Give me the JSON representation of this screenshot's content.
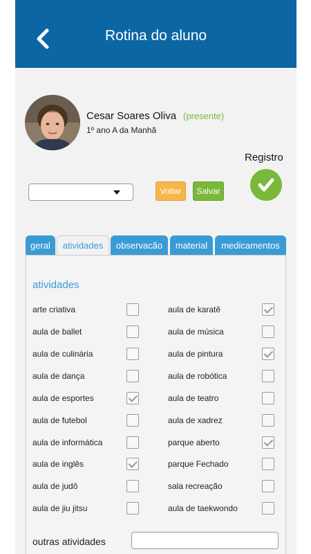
{
  "header": {
    "title": "Rotina do aluno"
  },
  "student": {
    "name": "Cesar Soares Oliva",
    "status": "(presente)",
    "class": "1º ano A da Manhã"
  },
  "registro": {
    "label": "Registro"
  },
  "select": {
    "value": ""
  },
  "buttons": {
    "voltar": "Voltar",
    "salvar": "Salvar"
  },
  "tabs": [
    {
      "label": "geral",
      "active": false
    },
    {
      "label": "atividades",
      "active": true
    },
    {
      "label": "observacão",
      "active": false
    },
    {
      "label": "material",
      "active": false
    },
    {
      "label": "medicamentos",
      "active": false
    }
  ],
  "section": {
    "title": "atividades"
  },
  "activities_left": [
    {
      "label": "arte criativa",
      "checked": false
    },
    {
      "label": "aula de ballet",
      "checked": false
    },
    {
      "label": "aula de culinária",
      "checked": false
    },
    {
      "label": "aula de dança",
      "checked": false
    },
    {
      "label": "aula de esportes",
      "checked": true
    },
    {
      "label": "aula de futebol",
      "checked": false
    },
    {
      "label": "aula de informática",
      "checked": false
    },
    {
      "label": "aula de inglês",
      "checked": true
    },
    {
      "label": "aula de judô",
      "checked": false
    },
    {
      "label": "aula de jiu jitsu",
      "checked": false
    }
  ],
  "activities_right": [
    {
      "label": "aula de karatê",
      "checked": true
    },
    {
      "label": "aula de música",
      "checked": false
    },
    {
      "label": "aula de pintura",
      "checked": true
    },
    {
      "label": "aula de robótica",
      "checked": false
    },
    {
      "label": "aula de teatro",
      "checked": false
    },
    {
      "label": "aula de xadrez",
      "checked": false
    },
    {
      "label": "parque aberto",
      "checked": true
    },
    {
      "label": "parque Fechado",
      "checked": false
    },
    {
      "label": "sala recreação",
      "checked": false
    },
    {
      "label": "aula de taekwondo",
      "checked": false
    }
  ],
  "outras": {
    "label": "outras atividades",
    "value": ""
  },
  "colors": {
    "header": "#0d66a4",
    "tab": "#3b9bd4",
    "present": "#7ab83a",
    "voltar": "#f8b54a",
    "salvar": "#7ab83a"
  },
  "icons": {
    "back": "chevron-left-icon",
    "registro": "checkmark-icon"
  }
}
